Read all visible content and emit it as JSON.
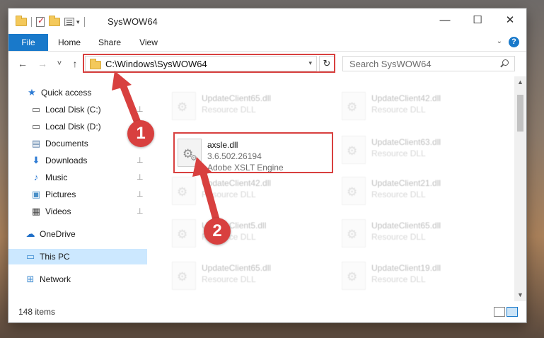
{
  "window": {
    "title": "SysWOW64",
    "controls": {
      "minimize": "—",
      "maximize": "☐",
      "close": "✕"
    }
  },
  "ribbon": {
    "tabs": [
      "File",
      "Home",
      "Share",
      "View"
    ],
    "help": "?",
    "accent": "#1979ca"
  },
  "navigation": {
    "back": "←",
    "forward": "→",
    "recent": "˅",
    "up": "↑",
    "address": "C:\\Windows\\SysWOW64",
    "refresh": "↻",
    "search_placeholder": "Search SysWOW64"
  },
  "sidebar": {
    "items": [
      {
        "label": "Quick access",
        "icon": "star-icon",
        "glyph": "★",
        "color": "#2d7bd4",
        "pinned": false
      },
      {
        "label": "Local Disk (C:)",
        "icon": "drive-icon",
        "glyph": "▭",
        "color": "#555555",
        "pinned": true
      },
      {
        "label": "Local Disk (D:)",
        "icon": "drive-icon",
        "glyph": "▭",
        "color": "#555555",
        "pinned": true
      },
      {
        "label": "Documents",
        "icon": "document-icon",
        "glyph": "▤",
        "color": "#5a7fa8",
        "pinned": true
      },
      {
        "label": "Downloads",
        "icon": "download-icon",
        "glyph": "⬇",
        "color": "#2d7bd4",
        "pinned": true
      },
      {
        "label": "Music",
        "icon": "music-icon",
        "glyph": "♪",
        "color": "#2d7bd4",
        "pinned": true
      },
      {
        "label": "Pictures",
        "icon": "pictures-icon",
        "glyph": "▣",
        "color": "#4a90c8",
        "pinned": true
      },
      {
        "label": "Videos",
        "icon": "video-icon",
        "glyph": "▦",
        "color": "#444444",
        "pinned": true
      },
      {
        "label": "OneDrive",
        "icon": "cloud-icon",
        "glyph": "☁",
        "color": "#1f6fc7",
        "pinned": false
      },
      {
        "label": "This PC",
        "icon": "monitor-icon",
        "glyph": "▭",
        "color": "#3c8ad1",
        "pinned": false,
        "selected": true
      },
      {
        "label": "Network",
        "icon": "network-icon",
        "glyph": "⊞",
        "color": "#3c8ad1",
        "pinned": false
      }
    ],
    "pin_glyph": "📌"
  },
  "files": {
    "highlight": {
      "name": "axsle.dll",
      "version": "3.6.502.26194",
      "description": "Adobe XSLT Engine"
    },
    "background": [
      {
        "name": "UpdateClient65.dll",
        "desc": "Resource DLL"
      },
      {
        "name": "UpdateClient42.dll",
        "desc": "Resource DLL"
      },
      {
        "name": "UpdateClient63.dll",
        "desc": "Resource DLL"
      },
      {
        "name": "UpdateClient42.dll",
        "desc": "Resource DLL"
      },
      {
        "name": "UpdateClient21.dll",
        "desc": "Resource DLL"
      },
      {
        "name": "UpdateClient5.dll",
        "desc": "Resource DLL"
      },
      {
        "name": "UpdateClient65.dll",
        "desc": "Resource DLL"
      },
      {
        "name": "UpdateClient65.dll",
        "desc": "Resource DLL"
      },
      {
        "name": "UpdateClient19.dll",
        "desc": "Resource DLL"
      }
    ]
  },
  "status": {
    "item_count": "148 items"
  },
  "annotations": {
    "step1": "1",
    "step2": "2",
    "color": "#d8403f"
  }
}
